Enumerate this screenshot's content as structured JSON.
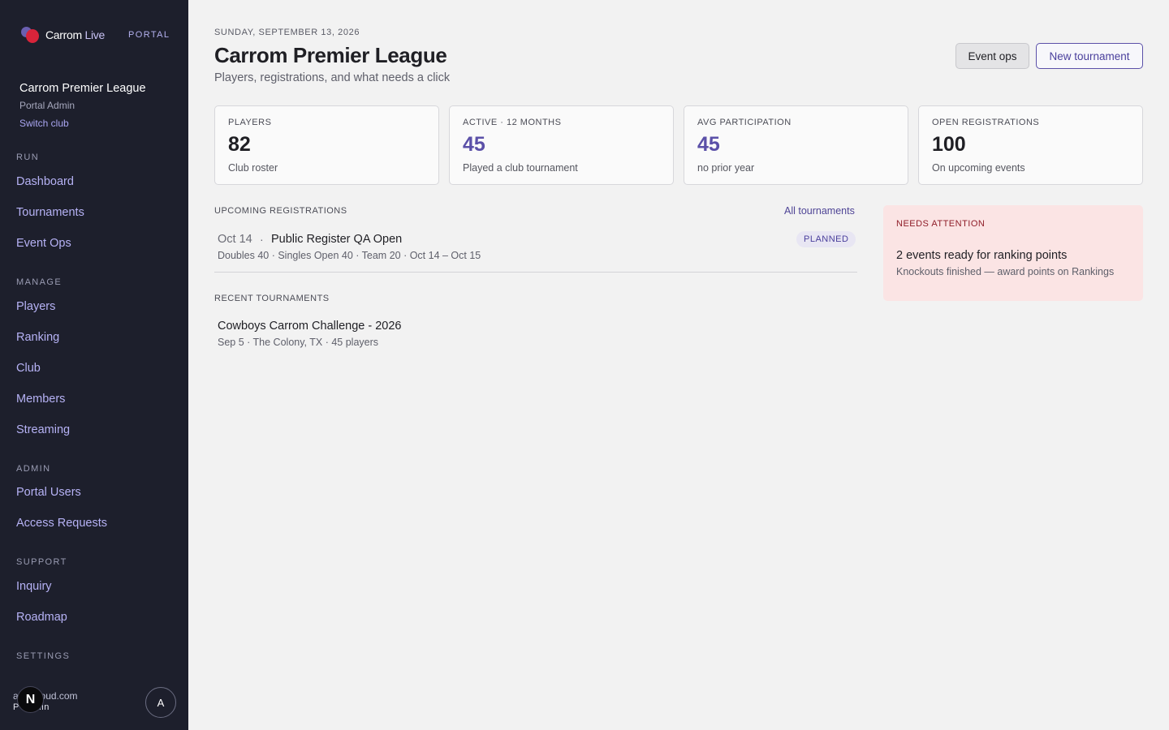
{
  "brand": {
    "name_part1": "Carrom ",
    "name_part2": "Live",
    "tag": "PORTAL"
  },
  "club": {
    "name": "Carrom Premier League",
    "role": "Portal Admin",
    "switch_label": "Switch club"
  },
  "nav": {
    "run": {
      "title": "RUN",
      "items": [
        "Dashboard",
        "Tournaments",
        "Event Ops"
      ]
    },
    "manage": {
      "title": "MANAGE",
      "items": [
        "Players",
        "Ranking",
        "Club",
        "Members",
        "Streaming"
      ]
    },
    "admin": {
      "title": "ADMIN",
      "items": [
        "Portal Users",
        "Access Requests"
      ]
    },
    "support": {
      "title": "SUPPORT",
      "items": [
        "Inquiry",
        "Roadmap"
      ]
    },
    "settings": {
      "title": "SETTINGS"
    }
  },
  "user": {
    "email": "a @icloud.com",
    "role": "P   Admin",
    "badge": "N",
    "avatar_initial": "A"
  },
  "header": {
    "date": "SUNDAY, SEPTEMBER 13, 2026",
    "title": "Carrom Premier League",
    "subtitle": "Players, registrations, and what needs a click",
    "event_ops_label": "Event ops",
    "new_tournament_label": "New tournament"
  },
  "stats": [
    {
      "label": "PLAYERS",
      "value": "82",
      "note": "Club roster"
    },
    {
      "label": "ACTIVE · 12 MONTHS",
      "value": "45",
      "note": "Played a club tournament"
    },
    {
      "label": "AVG PARTICIPATION",
      "value": "45",
      "note": "no prior year"
    },
    {
      "label": "OPEN REGISTRATIONS",
      "value": "100",
      "note": "On upcoming events"
    }
  ],
  "upcoming": {
    "title": "UPCOMING REGISTRATIONS",
    "all_link": "All tournaments",
    "items": [
      {
        "date": "Oct 14",
        "sep": "·",
        "name": "Public Register QA Open",
        "meta": "Doubles 40 · Singles Open 40 · Team 20 · Oct 14 – Oct 15",
        "status": "PLANNED"
      }
    ]
  },
  "recent": {
    "title": "RECENT TOURNAMENTS",
    "items": [
      {
        "name": "Cowboys Carrom Challenge - 2026",
        "meta": "Sep 5 · The Colony, TX · 45 players"
      }
    ]
  },
  "attention": {
    "title": "NEEDS ATTENTION",
    "item_title": "2 events ready for ranking points",
    "item_note": "Knockouts finished — award points on Rankings"
  },
  "colors": {
    "sidebar_bg": "#1d1f2c",
    "accent": "#5b50a8",
    "alert_bg": "#fbe4e4",
    "alert_text": "#8f1d28"
  }
}
